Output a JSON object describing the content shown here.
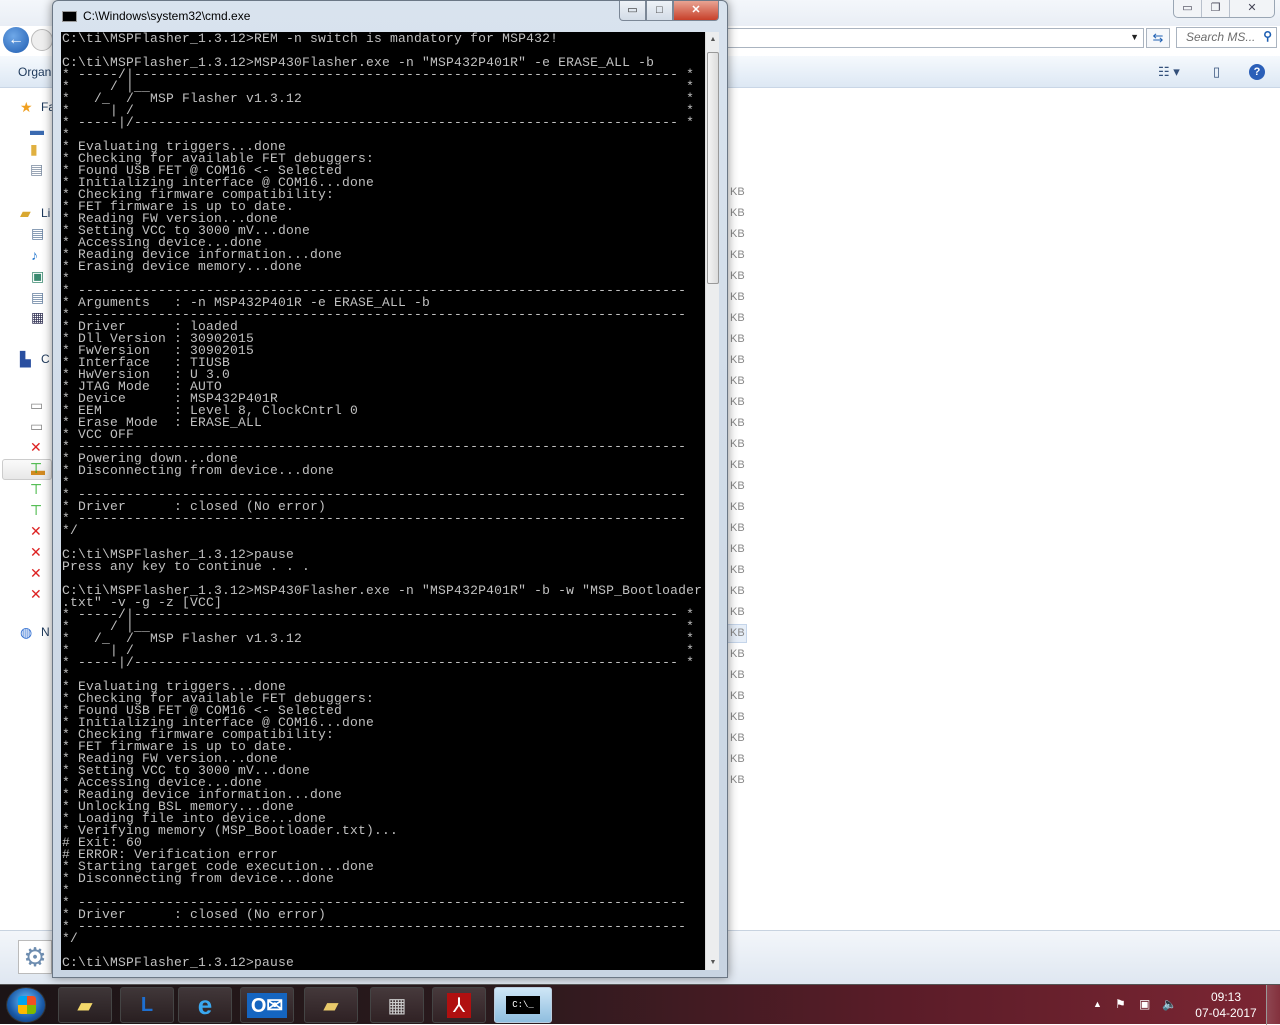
{
  "explorer": {
    "toolbar_organize": "Organ",
    "search_placeholder": "Search MS...",
    "nav_labels": {
      "favorites": "Fa",
      "libraries": "Li",
      "computer": "C",
      "network": "N"
    },
    "size_unit": "KB",
    "size_rows": 29
  },
  "cmd": {
    "title": "C:\\Windows\\system32\\cmd.exe",
    "icon_text": "C:\\_",
    "scrollbar_position": 0.12,
    "lines": [
      "C:\\ti\\MSPFlasher_1.3.12>REM -n switch is mandatory for MSP432!",
      "",
      "C:\\ti\\MSPFlasher_1.3.12>MSP430Flasher.exe -n \"MSP432P401R\" -e ERASE_ALL -b",
      "* -----/|-------------------------------------------------------------------- *",
      "*     / |__                                                                   *",
      "*   /_  /  MSP Flasher v1.3.12                                                *",
      "*     | /                                                                     *",
      "* -----|/-------------------------------------------------------------------- *",
      "*",
      "* Evaluating triggers...done",
      "* Checking for available FET debuggers:",
      "* Found USB FET @ COM16 <- Selected",
      "* Initializing interface @ COM16...done",
      "* Checking firmware compatibility:",
      "* FET firmware is up to date.",
      "* Reading FW version...done",
      "* Setting VCC to 3000 mV...done",
      "* Accessing device...done",
      "* Reading device information...done",
      "* Erasing device memory...done",
      "*",
      "* ----------------------------------------------------------------------------",
      "* Arguments   : -n MSP432P401R -e ERASE_ALL -b",
      "* ----------------------------------------------------------------------------",
      "* Driver      : loaded",
      "* Dll Version : 30902015",
      "* FwVersion   : 30902015",
      "* Interface   : TIUSB",
      "* HwVersion   : U 3.0",
      "* JTAG Mode   : AUTO",
      "* Device      : MSP432P401R",
      "* EEM         : Level 8, ClockCntrl 0",
      "* Erase Mode  : ERASE_ALL",
      "* VCC OFF",
      "* ----------------------------------------------------------------------------",
      "* Powering down...done",
      "* Disconnecting from device...done",
      "*",
      "* ----------------------------------------------------------------------------",
      "* Driver      : closed (No error)",
      "* ----------------------------------------------------------------------------",
      "*/",
      "",
      "C:\\ti\\MSPFlasher_1.3.12>pause",
      "Press any key to continue . . .",
      "",
      "C:\\ti\\MSPFlasher_1.3.12>MSP430Flasher.exe -n \"MSP432P401R\" -b -w \"MSP_Bootloader",
      ".txt\" -v -g -z [VCC]",
      "* -----/|-------------------------------------------------------------------- *",
      "*     / |__                                                                   *",
      "*   /_  /  MSP Flasher v1.3.12                                                *",
      "*     | /                                                                     *",
      "* -----|/-------------------------------------------------------------------- *",
      "*",
      "* Evaluating triggers...done",
      "* Checking for available FET debuggers:",
      "* Found USB FET @ COM16 <- Selected",
      "* Initializing interface @ COM16...done",
      "* Checking firmware compatibility:",
      "* FET firmware is up to date.",
      "* Reading FW version...done",
      "* Setting VCC to 3000 mV...done",
      "* Accessing device...done",
      "* Reading device information...done",
      "* Unlocking BSL memory...done",
      "* Loading file into device...done",
      "* Verifying memory (MSP_Bootloader.txt)...",
      "# Exit: 60",
      "# ERROR: Verification error",
      "* Starting target code execution...done",
      "* Disconnecting from device...done",
      "*",
      "* ----------------------------------------------------------------------------",
      "* Driver      : closed (No error)",
      "* ----------------------------------------------------------------------------",
      "*/",
      "",
      "C:\\ti\\MSPFlasher_1.3.12>pause"
    ]
  },
  "taskbar": {
    "apps": [
      "sticky-notes",
      "lync",
      "internet-explorer",
      "outlook",
      "file-explorer",
      "virtualbox",
      "adobe-reader",
      "command-prompt"
    ],
    "active_app": "command-prompt",
    "clock_time": "09:13",
    "clock_date": "07-04-2017"
  }
}
